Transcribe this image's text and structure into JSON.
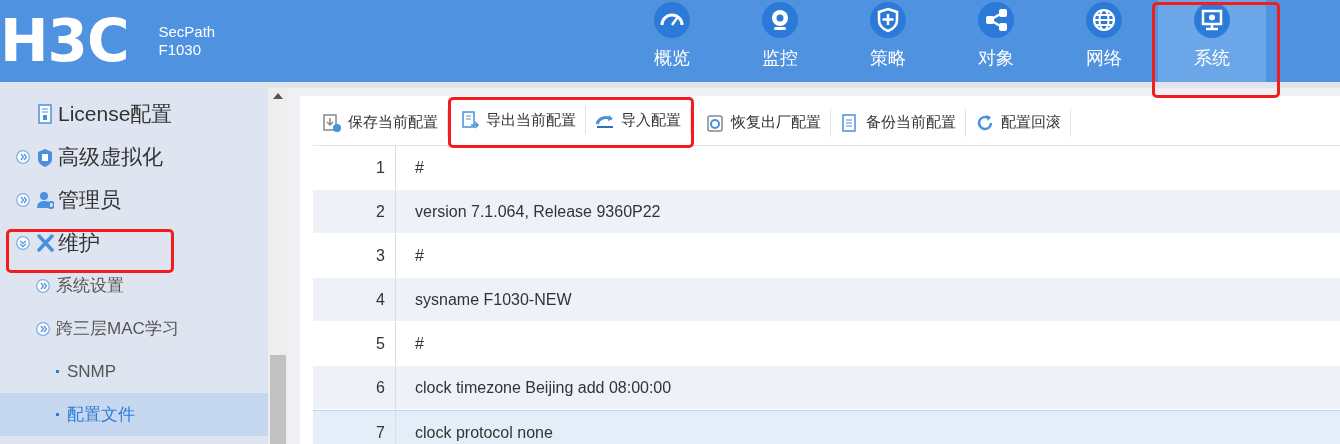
{
  "header": {
    "logo": "H3C",
    "product": "SecPath",
    "model": "F1030"
  },
  "nav": [
    {
      "label": "概览",
      "selected": false,
      "highlighted": false
    },
    {
      "label": "监控",
      "selected": false,
      "highlighted": false
    },
    {
      "label": "策略",
      "selected": false,
      "highlighted": false
    },
    {
      "label": "对象",
      "selected": false,
      "highlighted": false
    },
    {
      "label": "网络",
      "selected": false,
      "highlighted": false
    },
    {
      "label": "系统",
      "selected": true,
      "highlighted": true
    }
  ],
  "sidebar": {
    "items": [
      {
        "label": "License配置",
        "selected": false,
        "highlighted": false
      },
      {
        "label": "高级虚拟化",
        "expanded": false,
        "selected": false,
        "highlighted": false
      },
      {
        "label": "管理员",
        "expanded": false,
        "selected": false,
        "highlighted": false
      },
      {
        "label": "维护",
        "expanded": true,
        "selected": false,
        "highlighted": true,
        "children": [
          {
            "label": "系统设置",
            "expanded": false,
            "selected": false,
            "highlighted": false
          },
          {
            "label": "跨三层MAC学习",
            "expanded": false,
            "selected": false,
            "highlighted": false
          },
          {
            "label": "SNMP",
            "selected": false,
            "highlighted": false
          },
          {
            "label": "配置文件",
            "selected": true,
            "highlighted": false
          }
        ]
      }
    ]
  },
  "toolbar": [
    {
      "label": "保存当前配置",
      "highlighted": false
    },
    {
      "label": "导出当前配置",
      "highlighted": true
    },
    {
      "label": "导入配置",
      "highlighted": true
    },
    {
      "label": "恢复出厂配置",
      "highlighted": false
    },
    {
      "label": "备份当前配置",
      "highlighted": false
    },
    {
      "label": "配置回滚",
      "highlighted": false
    }
  ],
  "config_lines": [
    {
      "number": "1",
      "text": "#",
      "selected": false
    },
    {
      "number": "2",
      "text": "version 7.1.064, Release 9360P22",
      "selected": false
    },
    {
      "number": "3",
      "text": "#",
      "selected": false
    },
    {
      "number": "4",
      "text": "sysname F1030-NEW",
      "selected": false
    },
    {
      "number": "5",
      "text": "#",
      "selected": false
    },
    {
      "number": "6",
      "text": "clock timezone Beijing add 08:00:00",
      "selected": false
    },
    {
      "number": "7",
      "text": "clock protocol none",
      "selected": true
    }
  ]
}
